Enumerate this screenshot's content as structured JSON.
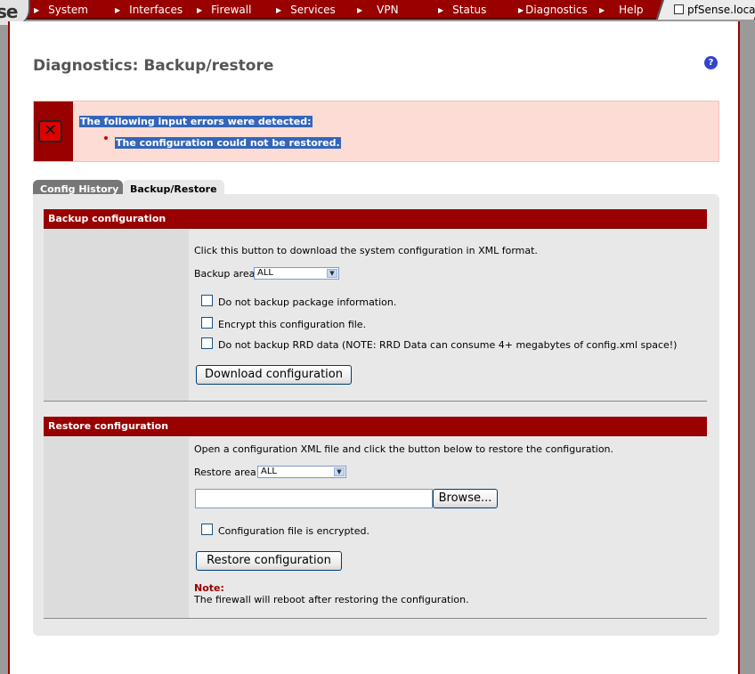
{
  "nav": {
    "logo_fragment": "se",
    "items": [
      "System",
      "Interfaces",
      "Firewall",
      "Services",
      "VPN",
      "Status",
      "Diagnostics",
      "Help"
    ],
    "host": "pfSense.loca"
  },
  "page": {
    "title": "Diagnostics: Backup/restore",
    "help": "?"
  },
  "errors": {
    "heading": "The following input errors were detected:",
    "items": [
      "The configuration could not be restored."
    ]
  },
  "tabs": [
    {
      "label": "Config History",
      "active": false
    },
    {
      "label": "Backup/Restore",
      "active": true
    }
  ],
  "backup": {
    "header": "Backup configuration",
    "description": "Click this button to download the system configuration in XML format.",
    "area_label": "Backup area:",
    "area_value": "ALL",
    "options": [
      {
        "label": "Do not backup package information.",
        "checked": false
      },
      {
        "label": "Encrypt this configuration file.",
        "checked": false
      },
      {
        "label": "Do not backup RRD data (NOTE: RRD Data can consume 4+ megabytes of config.xml space!)",
        "checked": false
      }
    ],
    "button": "Download configuration"
  },
  "restore": {
    "header": "Restore configuration",
    "description": "Open a configuration XML file and click the button below to restore the configuration.",
    "area_label": "Restore area:",
    "area_value": "ALL",
    "file_value": "",
    "browse_button": "Browse...",
    "encrypted_label": "Configuration file is encrypted.",
    "encrypted_checked": false,
    "button": "Restore configuration",
    "note_label": "Note:",
    "note_text": "The firewall will reboot after restoring the configuration."
  },
  "colors": {
    "brand": "#990000",
    "error_bg": "#fcdcd5",
    "selection": "#3366bb",
    "panel_bg": "#e8e8e8"
  }
}
